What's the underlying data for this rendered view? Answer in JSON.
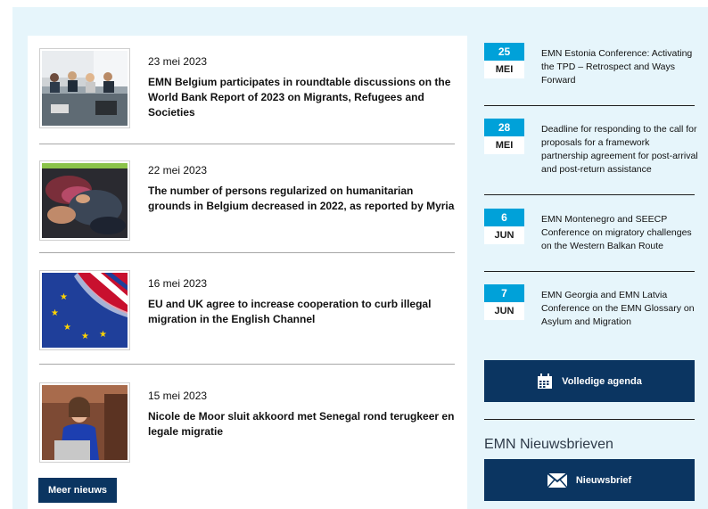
{
  "news": [
    {
      "date": "23 mei 2023",
      "title": "EMN Belgium participates in roundtable discussions on the World Bank Report of 2023 on Migrants, Refugees and Societies",
      "image": "conference-room-photo"
    },
    {
      "date": "22 mei 2023",
      "title": "The number of persons regularized on humanitarian grounds in Belgium decreased in 2022, as reported by Myria",
      "image": "hands-fabric-photo"
    },
    {
      "date": "16 mei 2023",
      "title": "EU and UK agree to increase cooperation to curb illegal migration in the English Channel",
      "image": "eu-uk-flags-photo"
    },
    {
      "date": "15 mei 2023",
      "title": "Nicole de Moor sluit akkoord met Senegal rond terugkeer en legale migratie",
      "image": "speaker-podium-photo"
    }
  ],
  "more_news_label": "Meer nieuws",
  "agenda": [
    {
      "day": "25",
      "month": "MEI",
      "title": "EMN Estonia Conference: Activating the TPD – Retrospect and Ways Forward"
    },
    {
      "day": "28",
      "month": "MEI",
      "title": "Deadline for responding to the call for proposals for a framework partnership agreement for post-arrival and post-return assistance"
    },
    {
      "day": "6",
      "month": "JUN",
      "title": "EMN Montenegro and SEECP Conference on migratory challenges on the Western Balkan Route"
    },
    {
      "day": "7",
      "month": "JUN",
      "title": "EMN Georgia and EMN Latvia Conference on the EMN Glossary on Asylum and Migration"
    }
  ],
  "full_agenda_label": "Volledige agenda",
  "newsletters_heading": "EMN Nieuwsbrieven",
  "newsletter_button_label": "Nieuwsbrief",
  "colors": {
    "panel_bg": "#e6f5fb",
    "navy": "#0b3561",
    "date_blue": "#00a1d9"
  }
}
